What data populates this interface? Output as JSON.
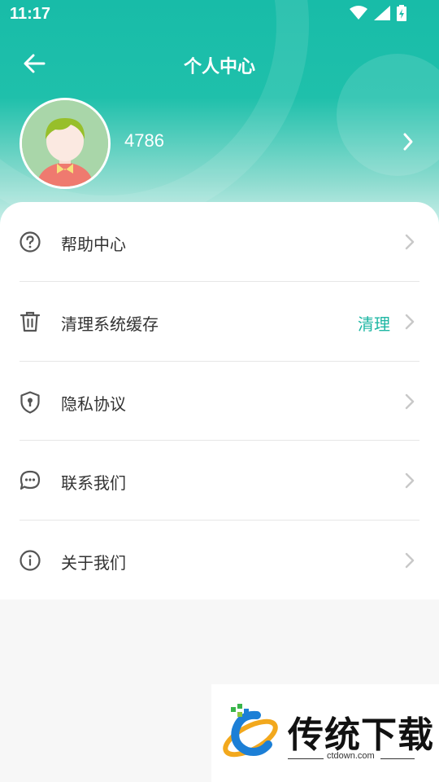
{
  "statusbar": {
    "time": "11:17"
  },
  "nav": {
    "title": "个人中心"
  },
  "profile": {
    "username": "4786"
  },
  "menu": [
    {
      "label": "帮助中心",
      "icon": "help-circle-icon"
    },
    {
      "label": "清理系统缓存",
      "icon": "trash-icon",
      "action": "清理"
    },
    {
      "label": "隐私协议",
      "icon": "shield-lock-icon"
    },
    {
      "label": "联系我们",
      "icon": "chat-bubble-icon"
    },
    {
      "label": "关于我们",
      "icon": "info-circle-icon"
    }
  ],
  "watermark": {
    "title": "传统下载",
    "subtitle": "ctdown.com"
  },
  "colors": {
    "accent": "#1fb7a4",
    "header": "#18bca8"
  }
}
